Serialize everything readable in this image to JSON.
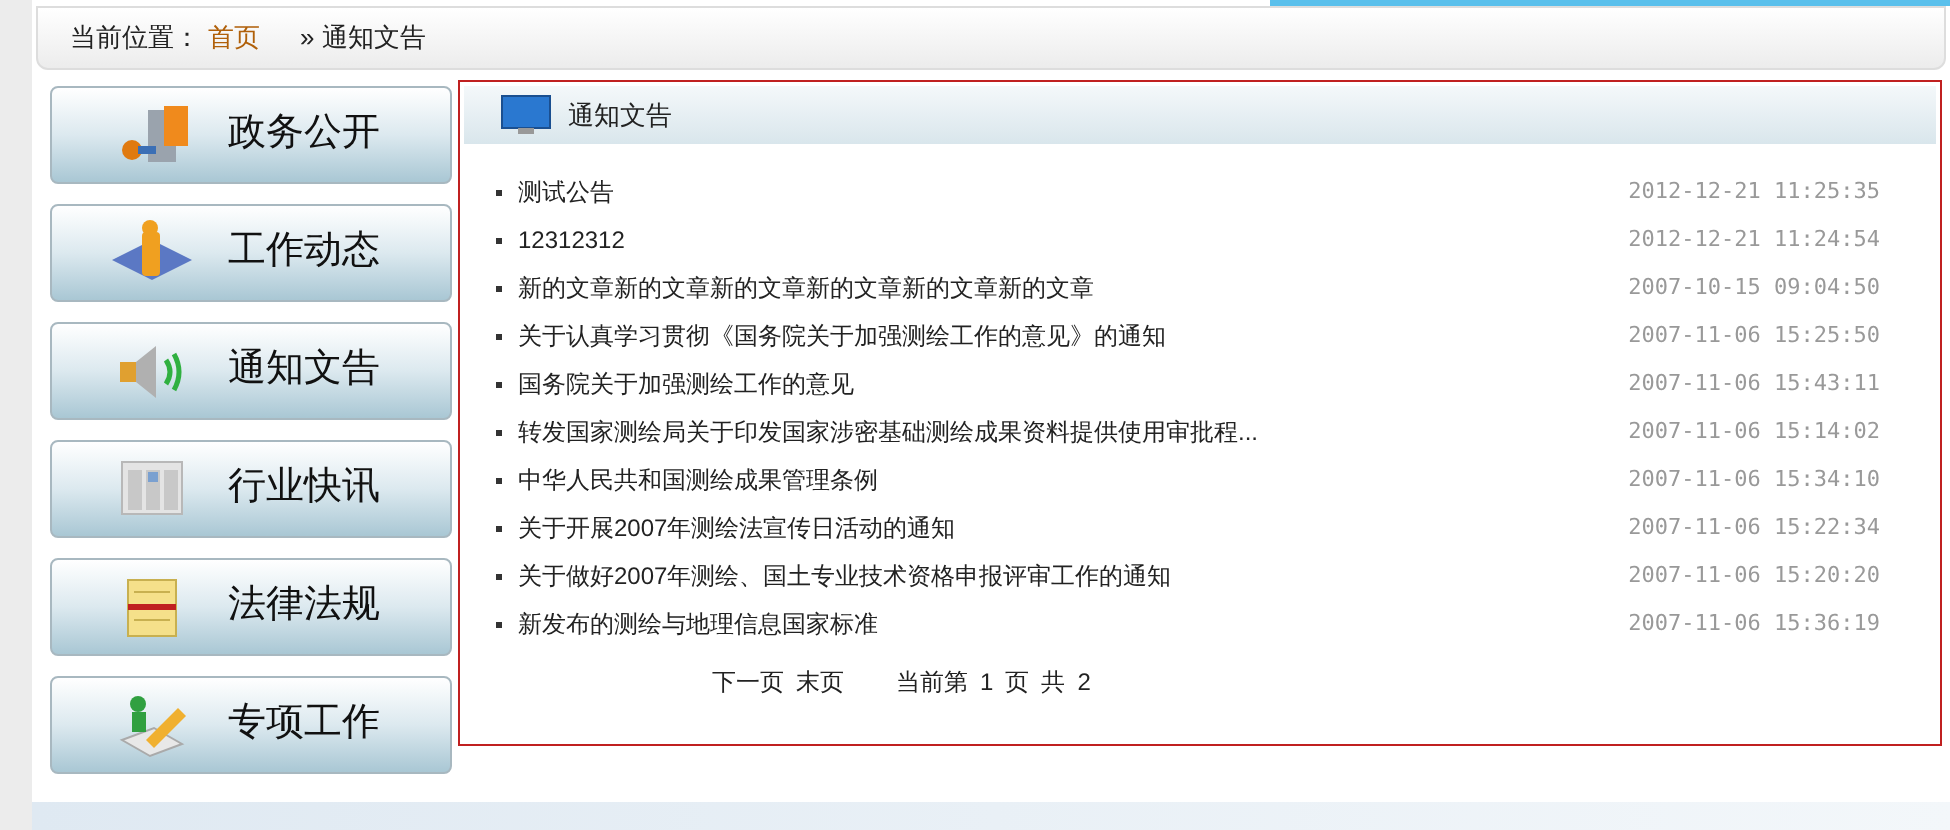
{
  "breadcrumb": {
    "label": "当前位置：",
    "home": "首页",
    "separator": "»",
    "current": "通知文告"
  },
  "sidebar": {
    "items": [
      {
        "label": "政务公开",
        "kind": "door"
      },
      {
        "label": "工作动态",
        "kind": "person"
      },
      {
        "label": "通知文告",
        "kind": "speaker"
      },
      {
        "label": "行业快讯",
        "kind": "newspaper"
      },
      {
        "label": "法律法规",
        "kind": "notepad"
      },
      {
        "label": "专项工作",
        "kind": "pencil"
      }
    ]
  },
  "panel": {
    "title": "通知文告",
    "rows": [
      {
        "title": "测试公告",
        "date": "2012-12-21 11:25:35"
      },
      {
        "title": "12312312",
        "date": "2012-12-21 11:24:54"
      },
      {
        "title": "新的文章新的文章新的文章新的文章新的文章新的文章",
        "date": "2007-10-15 09:04:50"
      },
      {
        "title": "关于认真学习贯彻《国务院关于加强测绘工作的意见》的通知",
        "date": "2007-11-06 15:25:50"
      },
      {
        "title": "国务院关于加强测绘工作的意见",
        "date": "2007-11-06 15:43:11"
      },
      {
        "title": "转发国家测绘局关于印发国家涉密基础测绘成果资料提供使用审批程...",
        "date": "2007-11-06 15:14:02"
      },
      {
        "title": "中华人民共和国测绘成果管理条例",
        "date": "2007-11-06 15:34:10"
      },
      {
        "title": "关于开展2007年测绘法宣传日活动的通知",
        "date": "2007-11-06 15:22:34"
      },
      {
        "title": "关于做好2007年测绘、国土专业技术资格申报评审工作的通知",
        "date": "2007-11-06 15:20:20"
      },
      {
        "title": "新发布的测绘与地理信息国家标准",
        "date": "2007-11-06 15:36:19"
      }
    ],
    "pagination": {
      "next": "下一页",
      "last": "末页",
      "current_label": "当前第",
      "current": "1",
      "page_label": "页",
      "total_label": "共",
      "total": "2"
    }
  }
}
